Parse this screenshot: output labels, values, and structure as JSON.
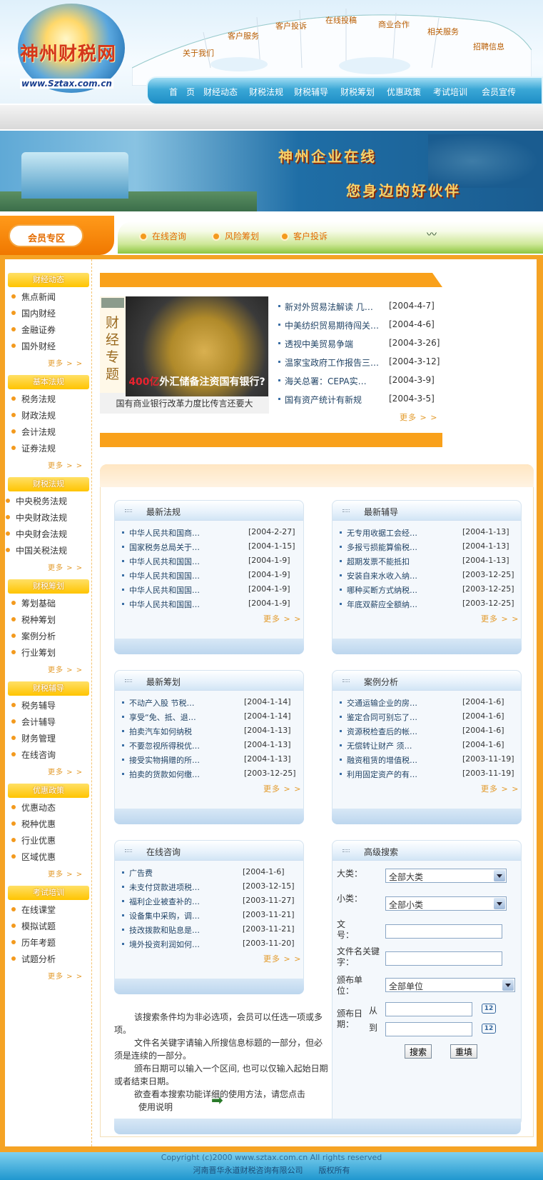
{
  "brand": {
    "name": "神州财税网",
    "url": "www.Sztax.com.cn"
  },
  "top_nav": [
    "关于我们",
    "客户服务",
    "客户投诉",
    "在线投稿",
    "商业合作",
    "相关服务",
    "招聘信息"
  ],
  "main_nav": [
    "首　页",
    "财经动态",
    "财税法规",
    "财税辅导",
    "财税筹划",
    "优惠政策",
    "考试培训",
    "会员宣传"
  ],
  "banner": {
    "line1": "神州企业在线",
    "line2": "您身边的好伙伴"
  },
  "member_bar": {
    "tab": "会员专区",
    "links": [
      "在线咨询",
      "风险筹划",
      "客户投诉"
    ]
  },
  "sidebar": [
    {
      "title": "财经动态",
      "items": [
        "焦点新闻",
        "国内财经",
        "金融证券",
        "国外财经"
      ],
      "more": "更多 > >"
    },
    {
      "title": "基本法规",
      "items": [
        "税务法规",
        "财政法规",
        "会计法规",
        "证券法规"
      ],
      "more": "更多 > >"
    },
    {
      "title": "财税法规",
      "items": [
        "中央税务法规",
        "中央财政法规",
        "中央财会法规",
        "中国关税法规"
      ],
      "more": "更多 > >"
    },
    {
      "title": "财税筹划",
      "items": [
        "筹划基础",
        "税种筹划",
        "案例分析",
        "行业筹划"
      ],
      "more": "更多 > >"
    },
    {
      "title": "财税辅导",
      "items": [
        "税务辅导",
        "会计辅导",
        "财务管理",
        "在线咨询"
      ],
      "more": "更多 > >"
    },
    {
      "title": "优惠政策",
      "items": [
        "优惠动态",
        "税种优惠",
        "行业优惠",
        "区域优惠"
      ],
      "more": "更多 > >"
    },
    {
      "title": "考试培训",
      "items": [
        "在线课堂",
        "模拟试题",
        "历年考题",
        "试题分析"
      ],
      "more": "更多 > >"
    }
  ],
  "feature": {
    "label": "财经专题",
    "image_text_red": "400亿",
    "image_text": "外汇储备注资国有银行?",
    "caption": "国有商业银行改革力度比传言还要大",
    "news": [
      {
        "title": "新对外贸易法解读  几…",
        "date": "[2004-4-7]"
      },
      {
        "title": "中美纺织贸易期待闯关…",
        "date": "[2004-4-6]"
      },
      {
        "title": "透视中美贸易争端",
        "date": "[2004-3-26]"
      },
      {
        "title": "温家宝政府工作报告三…",
        "date": "[2004-3-12]"
      },
      {
        "title": "海关总署：CEPA实…",
        "date": "[2004-3-9]"
      },
      {
        "title": "国有资产统计有新规",
        "date": "[2004-3-5]"
      }
    ],
    "more": "更多 > >"
  },
  "boxes": {
    "b1": {
      "title": "最新法规",
      "more": "更多 > >",
      "rows": [
        {
          "t": "中华人民共和国商…",
          "d": "[2004-2-27]"
        },
        {
          "t": "国家税务总局关于…",
          "d": "[2004-1-15]"
        },
        {
          "t": "中华人民共和国国…",
          "d": "[2004-1-9]"
        },
        {
          "t": "中华人民共和国国…",
          "d": "[2004-1-9]"
        },
        {
          "t": "中华人民共和国国…",
          "d": "[2004-1-9]"
        },
        {
          "t": "中华人民共和国国…",
          "d": "[2004-1-9]"
        }
      ]
    },
    "b2": {
      "title": "最新辅导",
      "more": "更多 > >",
      "rows": [
        {
          "t": "无专用收据工会经…",
          "d": "[2004-1-13]"
        },
        {
          "t": "多报亏损能算偷税…",
          "d": "[2004-1-13]"
        },
        {
          "t": "超期发票不能抵扣",
          "d": "[2004-1-13]"
        },
        {
          "t": "安装自来水收入纳…",
          "d": "[2003-12-25]"
        },
        {
          "t": "哪种买断方式纳税…",
          "d": "[2003-12-25]"
        },
        {
          "t": "年底双薪应全额纳…",
          "d": "[2003-12-25]"
        }
      ]
    },
    "b3": {
      "title": "最新筹划",
      "more": "更多 > >",
      "rows": [
        {
          "t": "不动产入股  节税…",
          "d": "[2004-1-14]"
        },
        {
          "t": "享受“免、抵、退…",
          "d": "[2004-1-14]"
        },
        {
          "t": "拍卖汽车如何纳税",
          "d": "[2004-1-13]"
        },
        {
          "t": "不要忽视所得税优…",
          "d": "[2004-1-13]"
        },
        {
          "t": "接受实物捐赠的所…",
          "d": "[2004-1-13]"
        },
        {
          "t": "拍卖的货款如何缴…",
          "d": "[2003-12-25]"
        }
      ]
    },
    "b4": {
      "title": "案例分析",
      "more": "更多 > >",
      "rows": [
        {
          "t": "交通运输企业的房…",
          "d": "[2004-1-6]"
        },
        {
          "t": "鉴定合同可别忘了…",
          "d": "[2004-1-6]"
        },
        {
          "t": "资源税检查后的帐…",
          "d": "[2004-1-6]"
        },
        {
          "t": "无偿转让财产  须…",
          "d": "[2004-1-6]"
        },
        {
          "t": "融资租赁的增值税…",
          "d": "[2003-11-19]"
        },
        {
          "t": "利用固定资产的有…",
          "d": "[2003-11-19]"
        }
      ]
    },
    "b5": {
      "title": "在线咨询",
      "more": "更多 > >",
      "rows": [
        {
          "t": "广告费",
          "d": "[2004-1-6]"
        },
        {
          "t": "未支付贷款进项税…",
          "d": "[2003-12-15]"
        },
        {
          "t": "福利企业被查补的…",
          "d": "[2003-11-27]"
        },
        {
          "t": "设备集中采购，调…",
          "d": "[2003-11-21]"
        },
        {
          "t": "技改拨款和贴息是…",
          "d": "[2003-11-21]"
        },
        {
          "t": "境外投资利润如何…",
          "d": "[2003-11-20]"
        }
      ]
    }
  },
  "search": {
    "title": "高级搜索",
    "category_label": "大类：",
    "category_value": "全部大类",
    "subcategory_label": "小类：",
    "subcategory_value": "全部小类",
    "docno_label": "文号：",
    "keyword_label": "文件名关键字：",
    "issuer_label": "颁布单位：",
    "issuer_value": "全部单位",
    "date_label": "颁布日期：",
    "from": "从",
    "to": "到",
    "search_btn": "搜索",
    "reset_btn": "重填"
  },
  "notes": {
    "p1": "该搜索条件均为非必选项，会员可以任选一项或多项。",
    "p2": "文件名关键字请输入所搜信息标题的一部分，但必须是连续的一部分。",
    "p3": "颁布日期可以输入一个区间, 也可以仅输入起始日期或者结束日期。",
    "p4": "欲查看本搜索功能详细的使用方法，请您点击",
    "link": "使用说明"
  },
  "footer": {
    "line1": "Copyright (c)2000 www.sztax.com.cn All rights reserved",
    "line2": "河南晋华永道财税咨询有限公司　　版权所有"
  }
}
